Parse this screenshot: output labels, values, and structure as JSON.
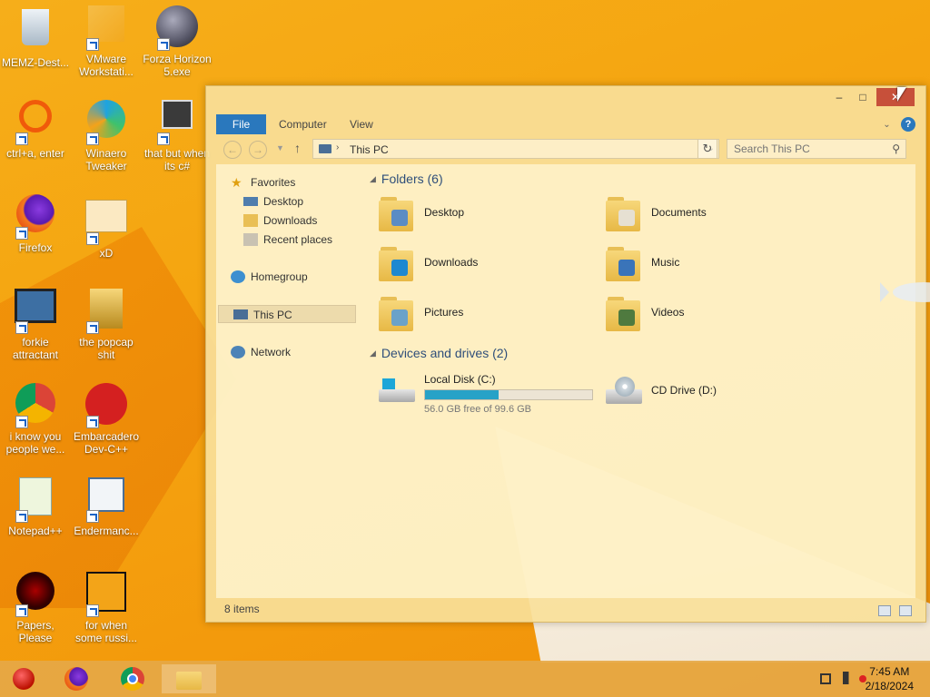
{
  "desktop": {
    "icons": [
      {
        "label": "MEMZ-Dest...",
        "icon": "recycle-bin-icon"
      },
      {
        "label": "VMware Workstati...",
        "icon": "vmware-icon"
      },
      {
        "label": "Forza Horizon 5.exe",
        "icon": "flash-player-icon"
      },
      {
        "label": "ctrl+a, enter",
        "icon": "orange-ring-icon"
      },
      {
        "label": "Winaero Tweaker",
        "icon": "winaero-icon"
      },
      {
        "label": "that but when its c#",
        "icon": "windows-stack-icon"
      },
      {
        "label": "Firefox",
        "icon": "firefox-icon"
      },
      {
        "label": "xD",
        "icon": "hxd-icon"
      },
      {
        "label": "forkie attractant",
        "icon": "gear-monitor-icon"
      },
      {
        "label": "the popcap shit",
        "icon": "popcap-folder-icon"
      },
      {
        "label": "i know you people we...",
        "icon": "chrome-icon"
      },
      {
        "label": "Embarcadero Dev-C++",
        "icon": "devcpp-icon"
      },
      {
        "label": "Notepad++",
        "icon": "notepadpp-icon"
      },
      {
        "label": "Endermanc...",
        "icon": "document-window-icon"
      },
      {
        "label": "Papers, Please",
        "icon": "papers-please-icon"
      },
      {
        "label": "for when some russi...",
        "icon": "de-icon"
      }
    ]
  },
  "window": {
    "controls": {
      "minimize": "–",
      "maximize": "□",
      "close": "✕"
    },
    "tabs": {
      "file": "File",
      "computer": "Computer",
      "view": "View"
    },
    "address": {
      "crumb": "This PC",
      "separator": "›"
    },
    "search": {
      "placeholder": "Search This PC"
    },
    "nav": {
      "favorites": "Favorites",
      "desktop": "Desktop",
      "downloads": "Downloads",
      "recent": "Recent places",
      "homegroup": "Homegroup",
      "thispc": "This PC",
      "network": "Network"
    },
    "folders_header": "Folders (6)",
    "folders": [
      {
        "name": "Desktop",
        "icon": "desktop-folder-icon"
      },
      {
        "name": "Documents",
        "icon": "documents-folder-icon"
      },
      {
        "name": "Downloads",
        "icon": "downloads-folder-icon"
      },
      {
        "name": "Music",
        "icon": "music-folder-icon"
      },
      {
        "name": "Pictures",
        "icon": "pictures-folder-icon"
      },
      {
        "name": "Videos",
        "icon": "videos-folder-icon"
      }
    ],
    "drives_header": "Devices and drives (2)",
    "drives": [
      {
        "name": "Local Disk (C:)",
        "free": "56.0 GB free of 99.6 GB",
        "used_fraction": 0.438
      },
      {
        "name": "CD Drive (D:)"
      }
    ],
    "status": "8 items"
  },
  "taskbar": {
    "time": "7:45 AM",
    "date": "2/18/2024"
  },
  "colors": {
    "accent": "#2a78bd",
    "close": "#c7503a",
    "drive_fill": "#27a2c7"
  }
}
